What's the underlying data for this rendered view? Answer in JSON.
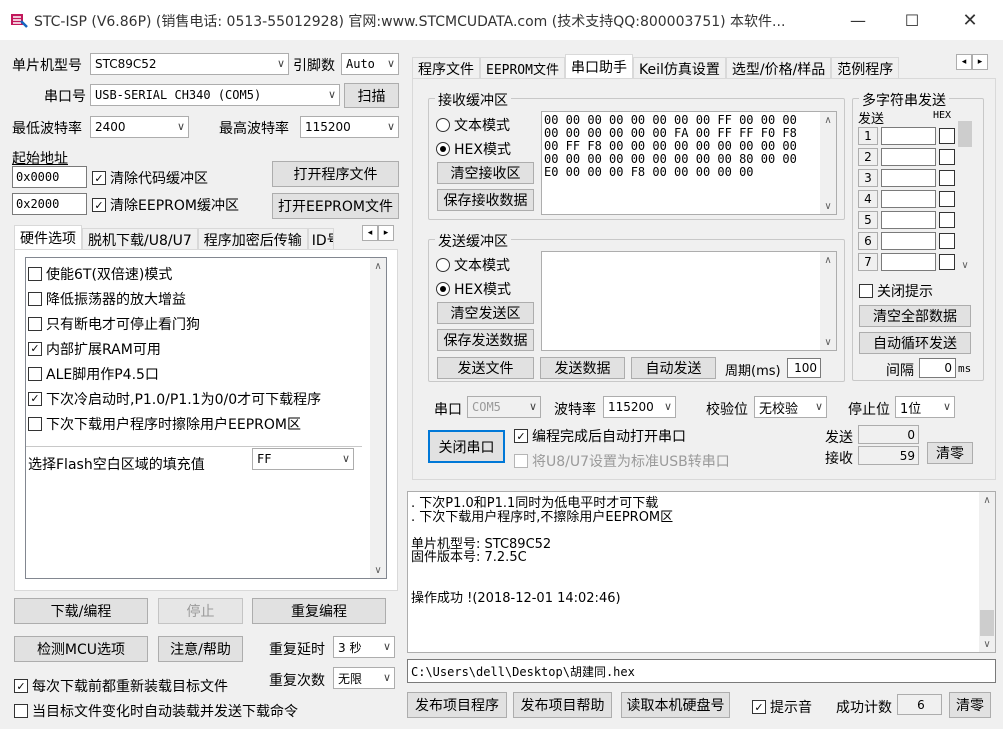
{
  "window": {
    "title": "STC-ISP (V6.86P) (销售电话: 0513-55012928) 官网:www.STCMCUDATA.com  (技术支持QQ:800003751) 本软件...",
    "min": "—",
    "max": "☐",
    "close": "✕"
  },
  "left": {
    "mcu_label": "单片机型号",
    "mcu_value": "STC89C52",
    "pins_label": "引脚数",
    "pins_value": "Auto",
    "port_label": "串口号",
    "port_value": "USB-SERIAL CH340 (COM5)",
    "scan": "扫描",
    "min_baud_label": "最低波特率",
    "min_baud_value": "2400",
    "max_baud_label": "最高波特率",
    "max_baud_value": "115200",
    "start_addr_label": "起始地址",
    "addr1": "0x0000",
    "clear_code": "清除代码缓冲区",
    "open_prog": "打开程序文件",
    "addr2": "0x2000",
    "clear_eeprom": "清除EEPROM缓冲区",
    "open_eeprom": "打开EEPROM文件",
    "tabs": [
      "硬件选项",
      "脱机下载/U8/U7",
      "程序加密后传输",
      "ID号"
    ],
    "options": [
      {
        "label": "使能6T(双倍速)模式",
        "checked": false
      },
      {
        "label": "降低振荡器的放大增益",
        "checked": false
      },
      {
        "label": "只有断电才可停止看门狗",
        "checked": false
      },
      {
        "label": "内部扩展RAM可用",
        "checked": true
      },
      {
        "label": "ALE脚用作P4.5口",
        "checked": false
      },
      {
        "label": "下次冷启动时,P1.0/P1.1为0/0才可下载程序",
        "checked": true
      },
      {
        "label": "下次下载用户程序时擦除用户EEPROM区",
        "checked": false
      }
    ],
    "fill_label": "选择Flash空白区域的填充值",
    "fill_value": "FF",
    "download": "下载/编程",
    "stop": "停止",
    "redo": "重复编程",
    "detect": "检测MCU选项",
    "help": "注意/帮助",
    "delay_label": "重复延时",
    "delay_value": "3 秒",
    "count_label": "重复次数",
    "count_value": "无限",
    "reload": "每次下载前都重新装载目标文件",
    "auto_send": "当目标文件变化时自动装载并发送下载命令"
  },
  "right": {
    "tabs": [
      "程序文件",
      "EEPROM文件",
      "串口助手",
      "Keil仿真设置",
      "选型/价格/样品",
      "范例程序"
    ],
    "recv_group": "接收缓冲区",
    "text_mode": "文本模式",
    "hex_mode": "HEX模式",
    "clear_recv": "清空接收区",
    "save_recv": "保存接收数据",
    "recv_lines": [
      "00 00 00 00 00 00 00 00 FF 00 00 00",
      "00 00 00 00 00 00 FA 00 FF FF F0 F8",
      "00 FF F8 00 00 00 00 00 00 00 00 00",
      "00 00 00 00 00 00 00 00 00 80 00 00",
      "E0 00 00 00 F8 00 00 00 00 00"
    ],
    "send_group": "发送缓冲区",
    "clear_send": "清空发送区",
    "save_send": "保存发送数据",
    "send_file": "发送文件",
    "send_data": "发送数据",
    "auto_send": "自动发送",
    "period_label": "周期(ms)",
    "period_value": "100",
    "multi_title": "多字符串发送",
    "send_hdr": "发送",
    "hex_hdr": "HEX",
    "multi_rows": [
      "1",
      "2",
      "3",
      "4",
      "5",
      "6",
      "7"
    ],
    "close_hint": "关闭提示",
    "clear_all": "清空全部数据",
    "auto_cycle": "自动循环发送",
    "interval_label": "间隔",
    "interval_value": "0",
    "interval_unit": "ms",
    "port_label": "串口",
    "port_value": "COM5",
    "baud_label": "波特率",
    "baud_value": "115200",
    "parity_label": "校验位",
    "parity_value": "无校验",
    "stop_label": "停止位",
    "stop_value": "1位",
    "close_port": "关闭串口",
    "auto_open": "编程完成后自动打开串口",
    "usb_set": "将U8/U7设置为标准USB转串口",
    "sent_label": "发送",
    "sent_value": "0",
    "recv_label": "接收",
    "recv_value": "59",
    "clear_counts": "清零"
  },
  "log": {
    "lines": [
      ". 下次P1.0和P1.1同时为低电平时才可下载",
      ". 下次下载用户程序时,不擦除用户EEPROM区",
      "",
      "单片机型号: STC89C52",
      "固件版本号: 7.2.5C",
      "",
      "",
      "操作成功 !(2018-12-01 14:02:46)"
    ]
  },
  "path": "C:\\Users\\dell\\Desktop\\胡建同.hex",
  "bottom": {
    "publish_prog": "发布项目程序",
    "publish_help": "发布项目帮助",
    "read_disk": "读取本机硬盘号",
    "beep": "提示音",
    "success_label": "成功计数",
    "success_value": "6",
    "clear": "清零"
  }
}
